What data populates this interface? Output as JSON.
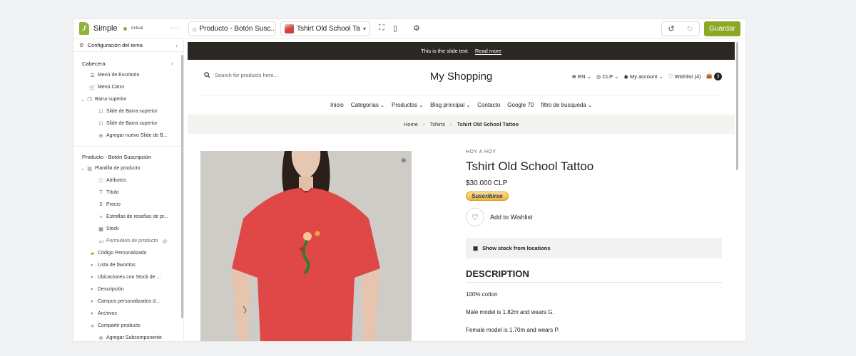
{
  "app": {
    "name": "Simple",
    "status": "Actual"
  },
  "toolbar": {
    "template_select": "Producto - Botón Susc...",
    "product_select": "Tshirt Old School Tatto",
    "save_label": "Guardar"
  },
  "sidebar": {
    "theme_config": "Configuración del tema",
    "header_section": "Cabecera",
    "header_items": [
      "Menú de Escritorio",
      "Menú Carro",
      "Barra superior",
      "Slide de Barra superior",
      "Slide de Barra superior",
      "Agregar nuevo Slide de B..."
    ],
    "template_section": "Producto - Botón Suscripción",
    "template_items": [
      "Plantilla de producto",
      "Atributos",
      "Título",
      "Precio",
      "Estrellas de reseñas de pr...",
      "Stock",
      "Formulario de producto",
      "Código Personalizado",
      "Lista de favoritos",
      "Ubicaciones con Stock de ...",
      "Descripción",
      "Campos personalizados d...",
      "Archivos",
      "Compartir producto",
      "Agregar Subcomponente"
    ]
  },
  "store": {
    "announcement": "This is the slide text",
    "announcement_link": "Read more",
    "search_placeholder": "Search for products here...",
    "shop_title": "My Shopping",
    "language": "EN",
    "currency": "CLP",
    "account": "My account",
    "wishlist": "Wishlist (4)",
    "cart_count": "3",
    "nav": [
      "Inicio",
      "Categorías",
      "Productos",
      "Blog principal",
      "Contacto",
      "Google 70",
      "filtro de busqueda"
    ],
    "breadcrumb": [
      "Home",
      "Tshirts",
      "Tshirt Old School Tattoo"
    ]
  },
  "product": {
    "vendor": "HOY A HOY",
    "title": "Tshirt Old School Tattoo",
    "price": "$30.000 CLP",
    "subscribe_label": "Suscribirse",
    "wishlist_label": "Add to Wishlist",
    "stock_label": "Show stock from locations",
    "description_heading": "DESCRIPTION",
    "description": [
      "100% cotton",
      "Male model is 1.82m and wears G.",
      "Female model is 1.70m and wears P."
    ]
  },
  "colors": {
    "accent": "#8aa823",
    "announcement_bg": "#2b2723",
    "tshirt": "#e04848"
  }
}
